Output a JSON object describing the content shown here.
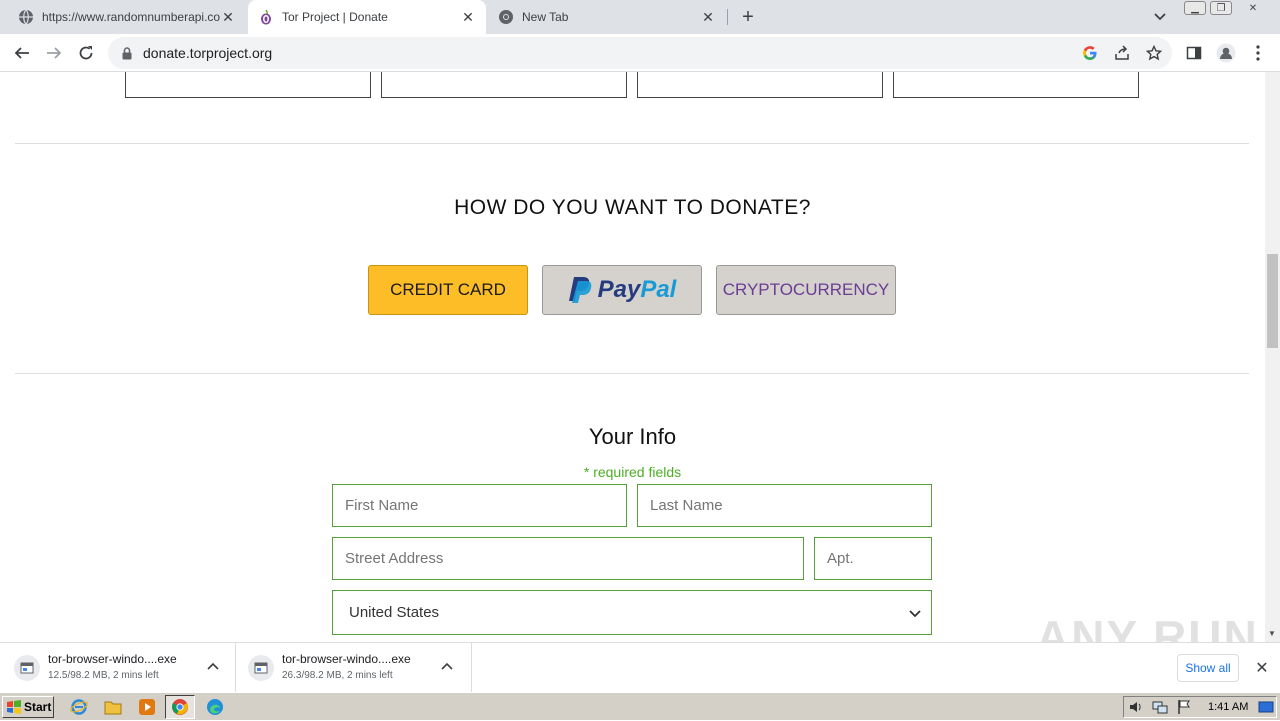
{
  "browser": {
    "tabs": [
      {
        "title": "https://www.randomnumberapi.com",
        "active": false
      },
      {
        "title": "Tor Project | Donate",
        "active": true
      },
      {
        "title": "New Tab",
        "active": false
      }
    ],
    "url": "donate.torproject.org"
  },
  "page": {
    "donate_heading": "HOW DO YOU WANT TO DONATE?",
    "payment_methods": {
      "credit_card": "CREDIT CARD",
      "paypal_pay": "Pay",
      "paypal_pal": "Pal",
      "crypto": "CRYPTOCURRENCY"
    },
    "your_info": {
      "title": "Your Info",
      "required_note": "* required fields",
      "first_name_placeholder": "First Name",
      "last_name_placeholder": "Last Name",
      "street_placeholder": "Street Address",
      "apt_placeholder": "Apt.",
      "country_value": "United States"
    },
    "watermark": "ANY RUN"
  },
  "downloads": {
    "items": [
      {
        "name": "tor-browser-windo....exe",
        "status": "12.5/98.2 MB, 2 mins left"
      },
      {
        "name": "tor-browser-windo....exe",
        "status": "26.3/98.2 MB, 2 mins left"
      }
    ],
    "show_all": "Show all"
  },
  "taskbar": {
    "start": "Start",
    "clock": "1:41 AM"
  },
  "colors": {
    "credit_card_bg": "#fdbd27",
    "field_border": "#55a039",
    "required_text": "#4caf24",
    "crypto_text": "#6b3c94",
    "paypal_dark": "#253b80",
    "paypal_light": "#179bd7"
  }
}
